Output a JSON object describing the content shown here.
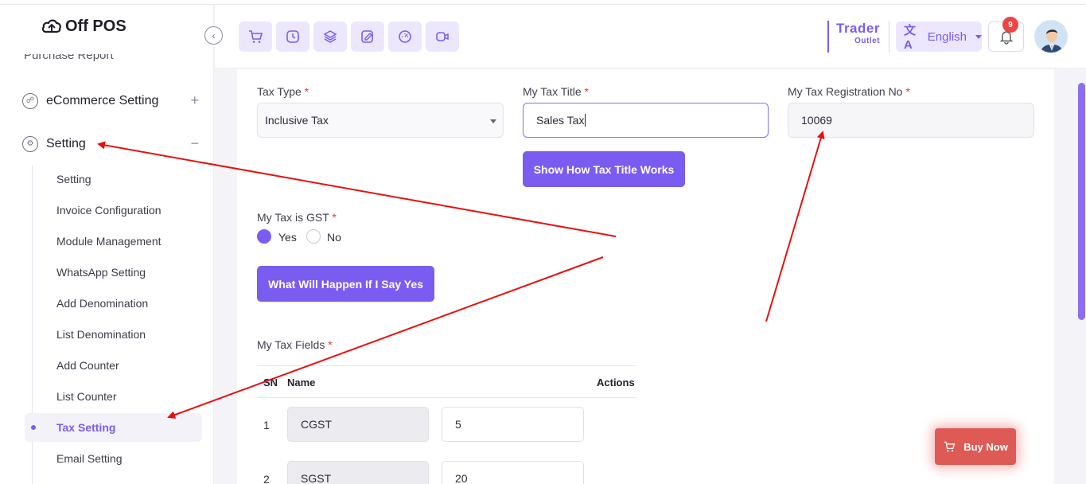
{
  "app": {
    "logo_text": "Off POS"
  },
  "sidebar": {
    "cutoff_item": "Purchase Report",
    "parents": [
      {
        "label": "eCommerce Setting",
        "sign": "+"
      },
      {
        "label": "Setting",
        "sign": "−"
      }
    ],
    "sub_items": [
      "Setting",
      "Invoice Configuration",
      "Module Management",
      "WhatsApp Setting",
      "Add Denomination",
      "List Denomination",
      "Add Counter",
      "List Counter",
      "Tax Setting",
      "Email Setting"
    ],
    "active_item": "Tax Setting"
  },
  "header": {
    "quick_icons": [
      "cart-icon",
      "clock-icon",
      "layers-icon",
      "edit-icon",
      "dashboard-icon",
      "video-icon"
    ],
    "trader_title": "Trader",
    "trader_subtitle": "Outlet",
    "language": "English",
    "notification_count": "9"
  },
  "form": {
    "tax_type": {
      "label": "Tax Type",
      "value": "Inclusive Tax"
    },
    "tax_title": {
      "label": "My Tax Title",
      "value": "Sales Tax"
    },
    "tax_reg": {
      "label": "My Tax Registration No",
      "value": "10069"
    },
    "show_btn": "Show How Tax Title Works",
    "gst": {
      "label": "My Tax is GST",
      "yes": "Yes",
      "no": "No",
      "selected": "Yes"
    },
    "gst_btn": "What Will Happen If I Say Yes",
    "fields_label": "My Tax Fields",
    "required_mark": "*",
    "table": {
      "headers": {
        "sn": "SN",
        "name": "Name",
        "actions": "Actions"
      },
      "rows": [
        {
          "sn": "1",
          "name": "CGST",
          "value": "5"
        },
        {
          "sn": "2",
          "name": "SGST",
          "value": "20"
        }
      ]
    }
  },
  "buy_now": "Buy Now",
  "colors": {
    "accent": "#7b5cf0",
    "accent_light": "#ece7fd",
    "danger": "#ef4444",
    "buy_now": "#dd5a55",
    "annotation_arrow": "#e8100f"
  }
}
